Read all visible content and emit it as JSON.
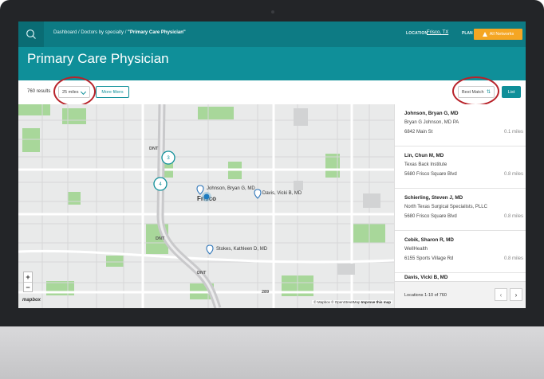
{
  "header": {
    "breadcrumb": "Dashboard / Doctors by specialty / ",
    "breadcrumb_current": "\"Primary Care Physician\"",
    "location_label": "LOCATION",
    "location_value": "Frisco, TX",
    "plan_label": "PLAN",
    "networks_label": "All Networks"
  },
  "page_title": "Primary Care Physician",
  "filters": {
    "result_count": "760 results",
    "distance": "25 miles",
    "more_filters": "More filters",
    "sort": "Best Match",
    "view_toggle": "List"
  },
  "map": {
    "clusters": [
      "3",
      "4"
    ],
    "markers": [
      "Johnson, Bryan G, MD",
      "Davis, Vicki B, MD",
      "Stokes, Kathleen D, MD"
    ],
    "city_label": "Frisco",
    "road_labels": [
      "DNT",
      "DNT",
      "DNT",
      "289"
    ],
    "zoom_in": "+",
    "zoom_out": "−",
    "logo": "mapbox",
    "attribution": "© Mapbox © OpenStreetMap",
    "improve": "Improve this map"
  },
  "results": [
    {
      "name": "Johnson, Bryan G, MD",
      "org": "Bryan G Johnson, MD PA",
      "address": "6842 Main St",
      "distance": "0.1 miles"
    },
    {
      "name": "Lin, Chun M, MD",
      "org": "Texas Back Institute",
      "address": "5680 Frisco Square Blvd",
      "distance": "0.8 miles"
    },
    {
      "name": "Schierling, Steven J, MD",
      "org": "North Texas Surgical Specialists, PLLC",
      "address": "5680 Frisco Square Blvd",
      "distance": "0.8 miles"
    },
    {
      "name": "Cebik, Sharon R, MD",
      "org": "WellHealth",
      "address": "6155 Sports Village Rd",
      "distance": "0.8 miles"
    },
    {
      "name": "Davis, Vicki B, MD",
      "org": "",
      "address": "",
      "distance": ""
    }
  ],
  "pagination": {
    "summary": "Locations 1-10 of 760",
    "prev": "‹",
    "next": "›"
  },
  "colors": {
    "header_teal": "#0d7b84",
    "hero_teal": "#0f8f99",
    "network_orange": "#f5a623",
    "highlight_ring": "#b8232a",
    "map_park_green": "#a8d79a"
  }
}
